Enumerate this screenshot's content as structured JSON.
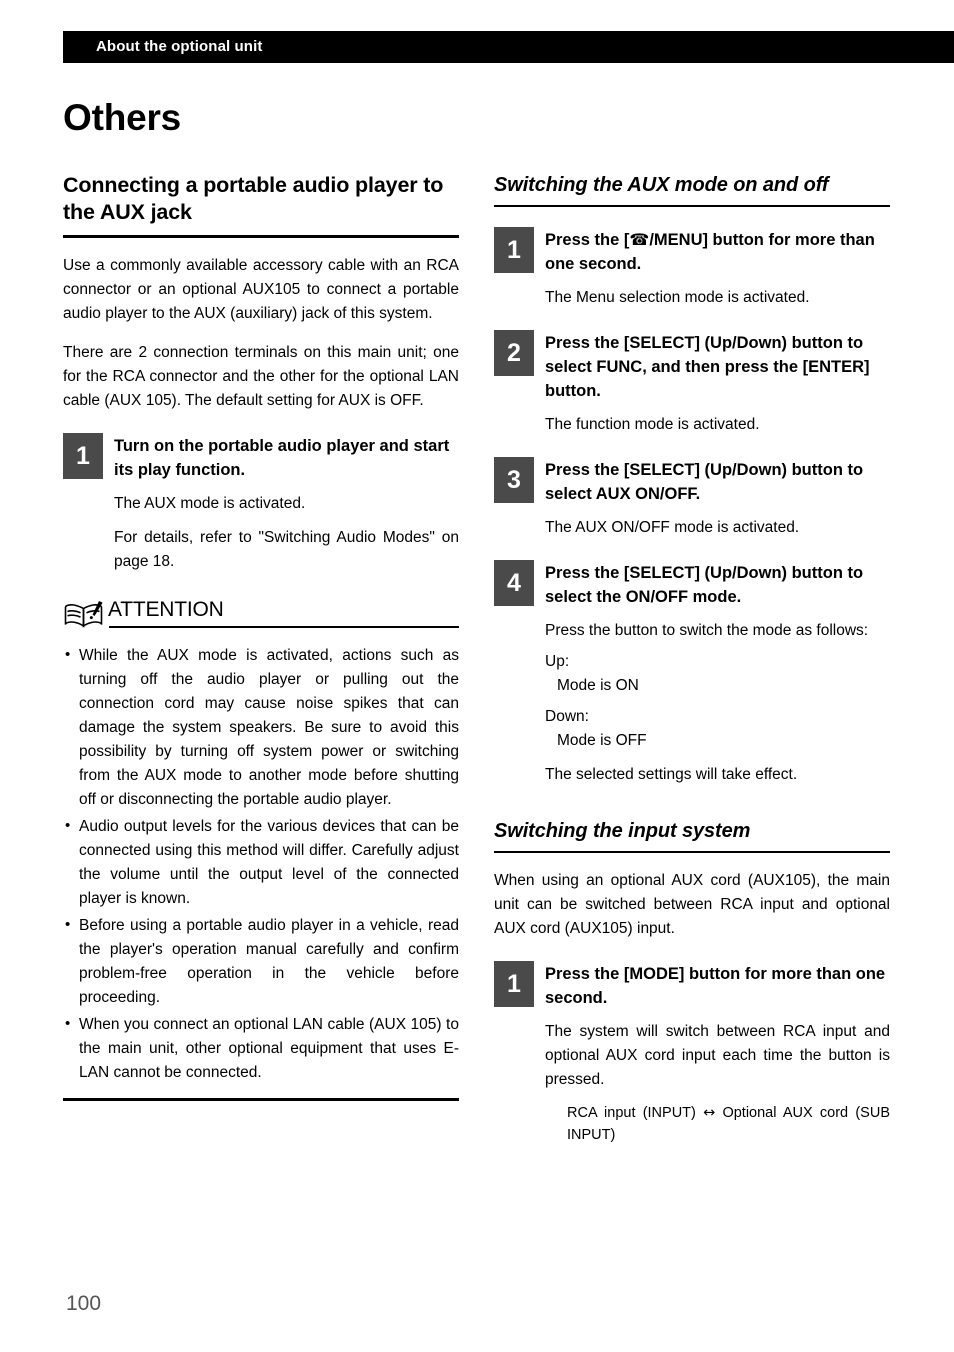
{
  "header": {
    "running_title": "About the optional unit"
  },
  "chapter_title": "Others",
  "page_number": "100",
  "left_column": {
    "section_heading": "Connecting a portable audio player to the AUX jack",
    "intro_paragraph_1": "Use a commonly available accessory cable with an RCA connector or an optional AUX105 to connect a portable audio player to the AUX (auxiliary) jack of this system.",
    "intro_paragraph_2": "There are 2 connection terminals on this main unit; one for the RCA connector and the other for the optional LAN cable (AUX 105). The default setting for AUX is OFF.",
    "steps": [
      {
        "number": "1",
        "title": "Turn on the portable audio player and start its play function.",
        "body_1": "The AUX mode is activated.",
        "body_2": "For details, refer to \"Switching Audio Modes\" on page 18."
      }
    ],
    "attention": {
      "icon": "open-book-exclamation-icon",
      "label": "ATTENTION",
      "notes": [
        "While the AUX mode is activated, actions such as turning off the audio player or pulling out the connection cord may cause noise spikes that can damage the system speakers. Be sure to avoid this possibility by turning off system power or switching from the AUX mode to another mode before shutting off or disconnecting the portable audio player.",
        "Audio output levels for the various devices that can be connected using this method will differ. Carefully adjust the volume until the output level of the connected player is known.",
        "Before using a portable audio player in a vehicle, read the player's operation manual carefully and confirm problem-free operation in the vehicle before proceeding.",
        "When you connect an optional LAN cable (AUX 105) to the main unit, other optional equipment that uses E-LAN cannot be connected."
      ]
    }
  },
  "right_column": {
    "section_1": {
      "heading": "Switching the AUX mode on and off",
      "steps": [
        {
          "number": "1",
          "title_before_icon": "Press the [",
          "icon": "telephone-icon",
          "title_after_icon": "/MENU] button for more than one second.",
          "body_1": "The Menu selection mode is activated."
        },
        {
          "number": "2",
          "title": "Press the [SELECT] (Up/Down) button to select FUNC, and then press the [ENTER] button.",
          "body_1": "The function mode is activated."
        },
        {
          "number": "3",
          "title": "Press the [SELECT] (Up/Down) button to select AUX ON/OFF.",
          "body_1": "The AUX ON/OFF mode is activated."
        },
        {
          "number": "4",
          "title": "Press the [SELECT] (Up/Down) button to select the ON/OFF mode.",
          "body_1": "Press the button to switch the mode as follows:",
          "body_2_label": "Up:",
          "body_2_value": "Mode is ON",
          "body_3_label": "Down:",
          "body_3_value": "Mode is OFF",
          "body_4": "The selected settings will take effect."
        }
      ]
    },
    "section_2": {
      "heading": "Switching the input system",
      "intro_paragraph": "When using an optional AUX cord (AUX105), the main unit can be switched between RCA input and optional AUX cord (AUX105) input.",
      "steps": [
        {
          "number": "1",
          "title": "Press the [MODE] button for more than one second.",
          "body_1": "The system will switch between RCA input and optional AUX cord input each time the button is pressed.",
          "body_2_before": "RCA input (INPUT) ",
          "body_2_arrow": "↔",
          "body_2_after": " Optional AUX cord (SUB INPUT)"
        }
      ]
    }
  },
  "colors": {
    "header_bar": "#000000",
    "step_box": "#4a4a4a",
    "page_number": "#555555",
    "text": "#000000"
  }
}
